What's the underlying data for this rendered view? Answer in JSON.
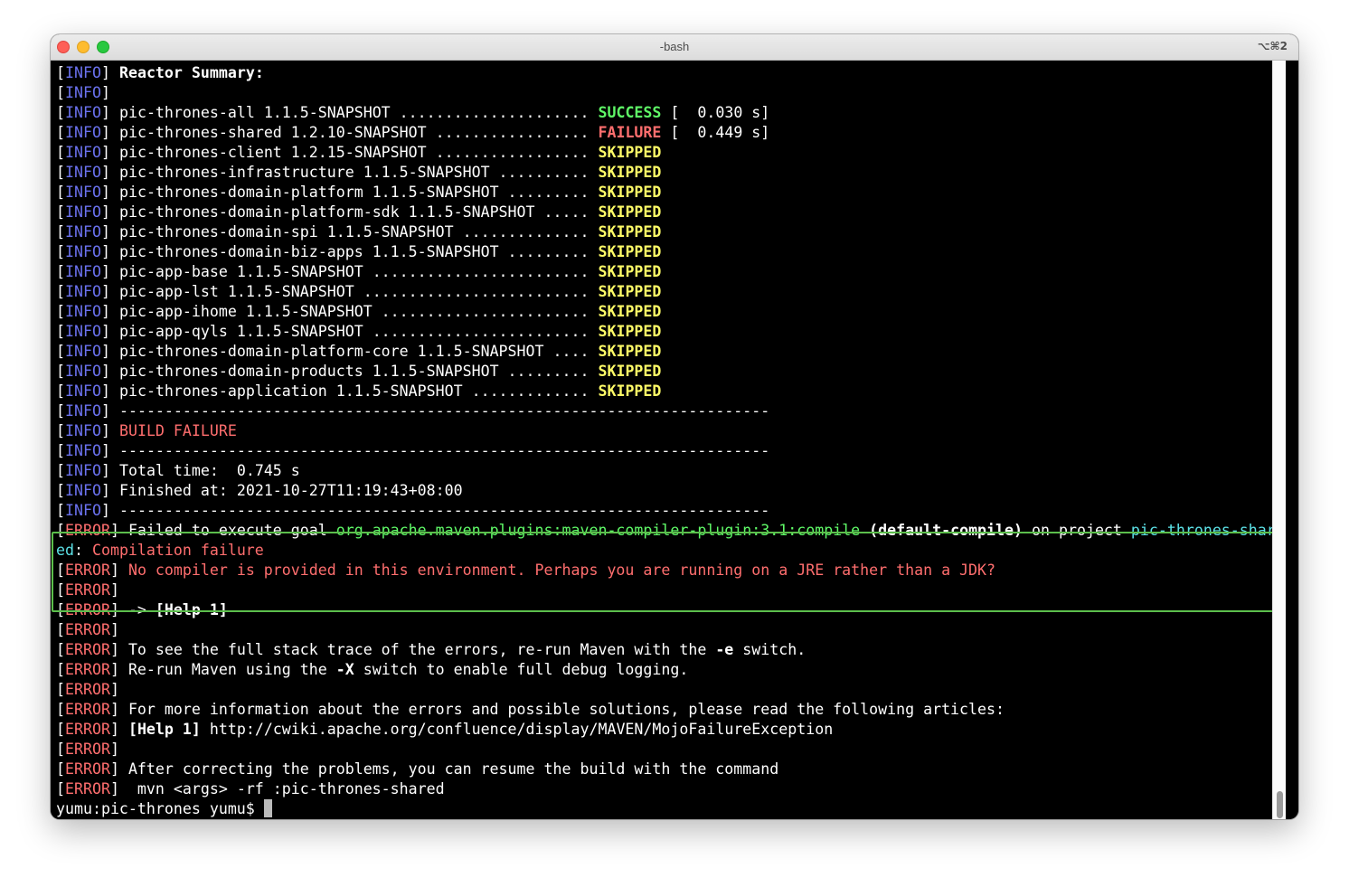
{
  "window": {
    "title": "-bash",
    "shortcut": "⌥⌘2"
  },
  "colors": {
    "info": "#6b72ef",
    "error": "#ff6e6e",
    "success": "#5ff967",
    "skipped": "#fefb67",
    "cyan": "#5ce2e7",
    "highlight_border": "#5cbe4c"
  },
  "terminal": {
    "tags": {
      "info": "INFO",
      "error": "ERROR"
    },
    "reactor_heading": "Reactor Summary:",
    "modules": [
      {
        "text": "pic-thrones-all 1.1.5-SNAPSHOT ..................... ",
        "status": "SUCCESS",
        "time": " [  0.030 s]"
      },
      {
        "text": "pic-thrones-shared 1.2.10-SNAPSHOT ................. ",
        "status": "FAILURE",
        "time": " [  0.449 s]"
      },
      {
        "text": "pic-thrones-client 1.2.15-SNAPSHOT ................. ",
        "status": "SKIPPED",
        "time": ""
      },
      {
        "text": "pic-thrones-infrastructure 1.1.5-SNAPSHOT .......... ",
        "status": "SKIPPED",
        "time": ""
      },
      {
        "text": "pic-thrones-domain-platform 1.1.5-SNAPSHOT ......... ",
        "status": "SKIPPED",
        "time": ""
      },
      {
        "text": "pic-thrones-domain-platform-sdk 1.1.5-SNAPSHOT ..... ",
        "status": "SKIPPED",
        "time": ""
      },
      {
        "text": "pic-thrones-domain-spi 1.1.5-SNAPSHOT .............. ",
        "status": "SKIPPED",
        "time": ""
      },
      {
        "text": "pic-thrones-domain-biz-apps 1.1.5-SNAPSHOT ......... ",
        "status": "SKIPPED",
        "time": ""
      },
      {
        "text": "pic-app-base 1.1.5-SNAPSHOT ........................ ",
        "status": "SKIPPED",
        "time": ""
      },
      {
        "text": "pic-app-lst 1.1.5-SNAPSHOT ......................... ",
        "status": "SKIPPED",
        "time": ""
      },
      {
        "text": "pic-app-ihome 1.1.5-SNAPSHOT ....................... ",
        "status": "SKIPPED",
        "time": ""
      },
      {
        "text": "pic-app-qyls 1.1.5-SNAPSHOT ........................ ",
        "status": "SKIPPED",
        "time": ""
      },
      {
        "text": "pic-thrones-domain-platform-core 1.1.5-SNAPSHOT .... ",
        "status": "SKIPPED",
        "time": ""
      },
      {
        "text": "pic-thrones-domain-products 1.1.5-SNAPSHOT ......... ",
        "status": "SKIPPED",
        "time": ""
      },
      {
        "text": "pic-thrones-application 1.1.5-SNAPSHOT ............. ",
        "status": "SKIPPED",
        "time": ""
      }
    ],
    "separator": "------------------------------------------------------------------------",
    "build_failure": "BUILD FAILURE",
    "total_time": "Total time:  0.745 s",
    "finished_at": "Finished at: 2021-10-27T11:19:43+08:00",
    "error_goal": {
      "prefix": " Failed to execute goal ",
      "plugin": "org.apache.maven.plugins:maven-compiler-plugin:3.1:compile",
      "execution": "(default-compile)",
      "on_project": " on project ",
      "project_part1": "pic-thrones-shar",
      "project_part2": "ed",
      "reason_sep": ": ",
      "reason": "Compilation failure"
    },
    "no_compiler": "No compiler is provided in this environment. Perhaps you are running on a JRE rather than a JDK?",
    "arrow": " -> ",
    "help1": "[Help 1]",
    "stack_trace_pre": " To see the full stack trace of the errors, re-run Maven with the ",
    "stack_trace_flag": "-e",
    "stack_trace_post": " switch.",
    "debug_pre": " Re-run Maven using the ",
    "debug_flag": "-X",
    "debug_post": " switch to enable full debug logging.",
    "more_info": " For more information about the errors and possible solutions, please read the following articles:",
    "help_url": " http://cwiki.apache.org/confluence/display/MAVEN/MojoFailureException",
    "after_correcting": " After correcting the problems, you can resume the build with the command",
    "resume_command": "  mvn <args> -rf :pic-thrones-shared",
    "prompt": "yumu:pic-thrones yumu$ "
  }
}
